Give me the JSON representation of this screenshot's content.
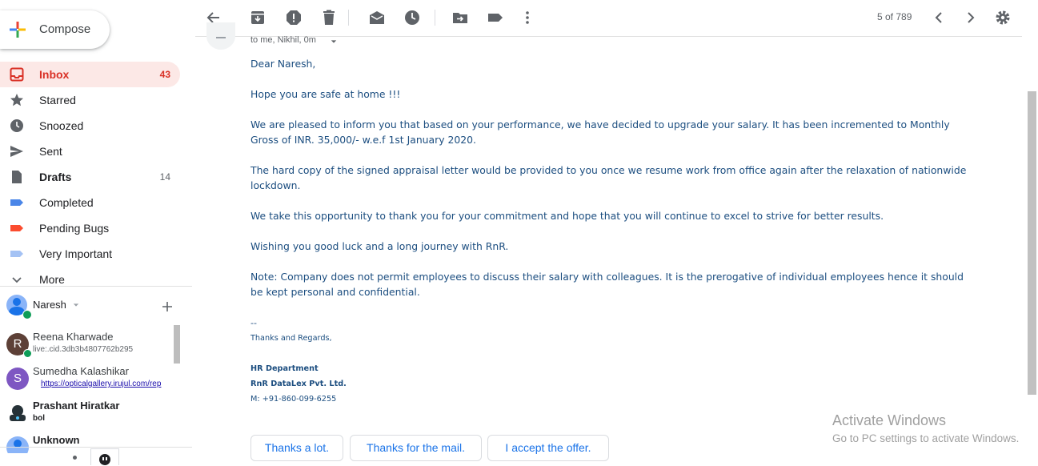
{
  "compose": {
    "label": "Compose"
  },
  "nav": [
    {
      "name": "inbox",
      "label": "Inbox",
      "count": "43",
      "icon": "inbox-icon"
    },
    {
      "name": "starred",
      "label": "Starred",
      "count": "",
      "icon": "star-icon"
    },
    {
      "name": "snoozed",
      "label": "Snoozed",
      "count": "",
      "icon": "clock-icon"
    },
    {
      "name": "sent",
      "label": "Sent",
      "count": "",
      "icon": "send-icon"
    },
    {
      "name": "drafts",
      "label": "Drafts",
      "count": "14",
      "icon": "draft-icon"
    },
    {
      "name": "completed",
      "label": "Completed",
      "count": "",
      "icon": "label-icon"
    },
    {
      "name": "pending-bugs",
      "label": "Pending Bugs",
      "count": "",
      "icon": "label-icon"
    },
    {
      "name": "very-important",
      "label": "Very Important",
      "count": "",
      "icon": "label-icon"
    },
    {
      "name": "more",
      "label": "More",
      "count": "",
      "icon": "chevron-down-icon"
    }
  ],
  "colors": {
    "inbox_red": "#d93025",
    "completed": "#4a86e8",
    "pending_bugs": "#fb4c2f",
    "very_important": "#a4c2f4",
    "body_text": "#1c4e80"
  },
  "hangouts": {
    "user": "Naresh",
    "chats": [
      {
        "name": "Reena Kharwade",
        "sub": "live:.cid.3db3b4807762b295",
        "initial": "R"
      },
      {
        "name": "Sumedha Kalashikar",
        "sub": "https://opticalgallery.irujul.com/rep",
        "initial": "S"
      },
      {
        "name": "Prashant Hiratkar",
        "sub": "bol",
        "initial": ""
      },
      {
        "name": "Unknown",
        "sub": "",
        "initial": ""
      }
    ]
  },
  "toolbar": {
    "pager": "5 of 789"
  },
  "message": {
    "meta": "to me, Nikhil, 0m",
    "greeting": "Dear Naresh,",
    "p1": "Hope you are safe at home !!!",
    "p2a": "We are pleased to inform you that based on your performance, we have decided to upgrade your salary. It has been incremented to Monthly",
    "p2b": "Gross of INR. 35,000/- w.e.f 1st January 2020.",
    "p3a": "The hard copy of the signed appraisal letter would be provided to you once we resume work from office again after the relaxation of nationwide",
    "p3b": "lockdown.",
    "p4": "We take this opportunity to thank you for your commitment and hope that you will continue to excel to strive for better results.",
    "p5": "Wishing you good luck and a long journey with RnR.",
    "p6a": "Note: Company does not permit employees to discuss their salary with colleagues. It is the prerogative of individual employees hence it should",
    "p6b": "be kept personal and confidential.",
    "sig_dash": "--",
    "sig_thanks": "Thanks and Regards,",
    "sig_dept": "HR Department",
    "sig_company": "RnR DataLex Pvt. Ltd.",
    "sig_phone": "M: +91-860-099-6255"
  },
  "smart_replies": [
    "Thanks a lot.",
    "Thanks for the mail.",
    "I accept the offer."
  ],
  "watermark": {
    "line1": "Activate Windows",
    "line2": "Go to PC settings to activate Windows."
  }
}
